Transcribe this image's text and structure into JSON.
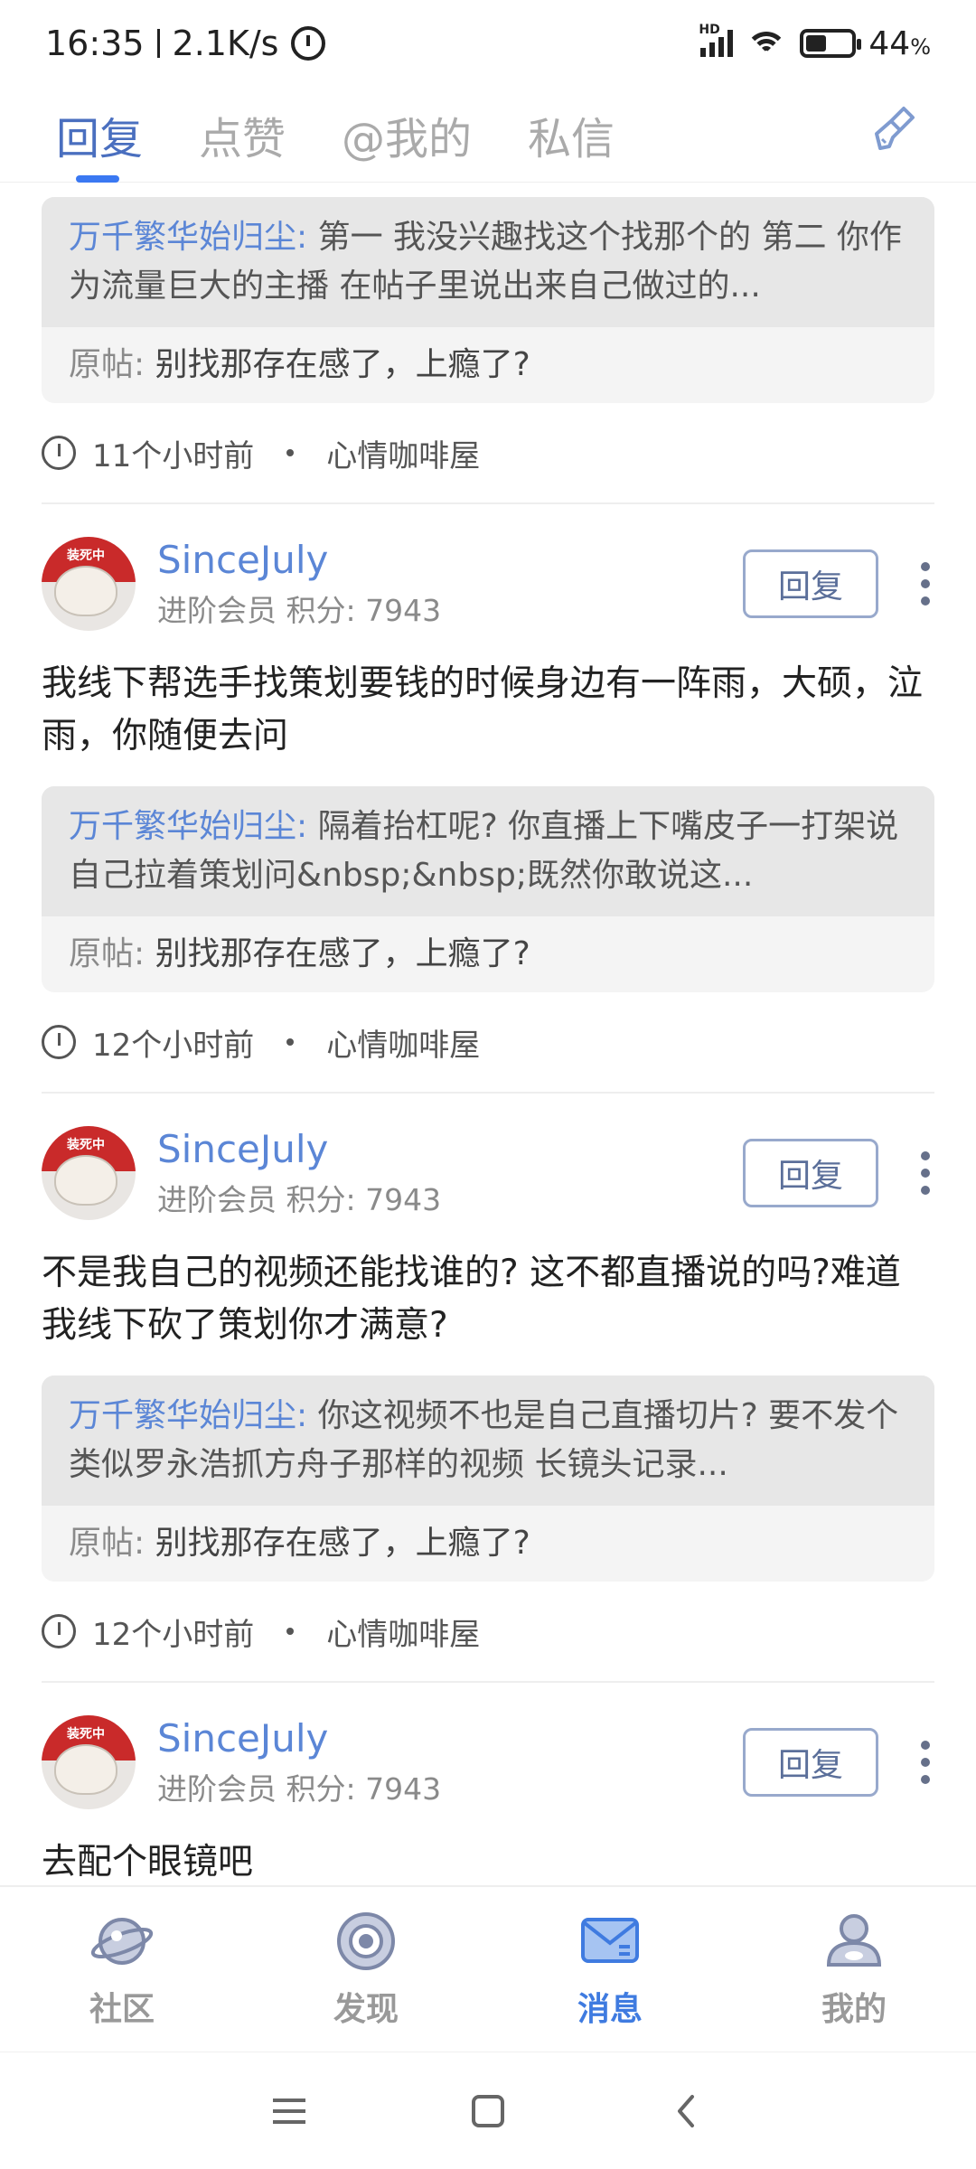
{
  "status_bar": {
    "time": "16:35",
    "speed": "2.1K/s",
    "network_badge": "HD",
    "battery_percent": "44",
    "battery_unit": "%"
  },
  "top_tabs": [
    {
      "label": "回复",
      "active": true
    },
    {
      "label": "点赞",
      "active": false
    },
    {
      "label": "@我的",
      "active": false
    },
    {
      "label": "私信",
      "active": false
    }
  ],
  "reply_button_label": "回复",
  "items": [
    {
      "partial": true,
      "quote_author": "万千繁华始归尘:",
      "quote_text": " 第一 我没兴趣找这个找那个的 第二 你作为流量巨大的主播 在帖子里说出来自己做过的...",
      "origin_label": "原帖:",
      "origin_text": " 别找那存在感了，上瘾了?",
      "time": "11个小时前",
      "forum": "心情咖啡屋"
    },
    {
      "username": "SinceJuly",
      "userinfo": "进阶会员  积分: 7943",
      "content": "我线下帮选手找策划要钱的时候身边有一阵雨，大硕，泣雨，你随便去问",
      "quote_author": "万千繁华始归尘:",
      "quote_text": " 隔着抬杠呢? 你直播上下嘴皮子一打架说自己拉着策划问&nbsp;&nbsp;既然你敢说这...",
      "origin_label": "原帖:",
      "origin_text": " 别找那存在感了，上瘾了?",
      "time": "12个小时前",
      "forum": "心情咖啡屋"
    },
    {
      "username": "SinceJuly",
      "userinfo": "进阶会员  积分: 7943",
      "content": "不是我自己的视频还能找谁的? 这不都直播说的吗?难道我线下砍了策划你才满意?",
      "quote_author": "万千繁华始归尘:",
      "quote_text": " 你这视频不也是自己直播切片?  要不发个类似罗永浩抓方舟子那样的视频 长镜头记录...",
      "origin_label": "原帖:",
      "origin_text": " 别找那存在感了，上瘾了?",
      "time": "12个小时前",
      "forum": "心情咖啡屋"
    },
    {
      "username": "SinceJuly",
      "userinfo": "进阶会员  积分: 7943",
      "content": "去配个眼镜吧"
    }
  ],
  "bottom_nav": [
    {
      "label": "社区",
      "icon": "planet-icon",
      "active": false
    },
    {
      "label": "发现",
      "icon": "target-icon",
      "active": false
    },
    {
      "label": "消息",
      "icon": "mail-icon",
      "active": true
    },
    {
      "label": "我的",
      "icon": "profile-icon",
      "active": false
    }
  ],
  "colors": {
    "accent": "#4a6fbf",
    "link": "#5b86d6",
    "active_nav": "#3f7be0",
    "tab_indicator": "#3a78f2"
  }
}
